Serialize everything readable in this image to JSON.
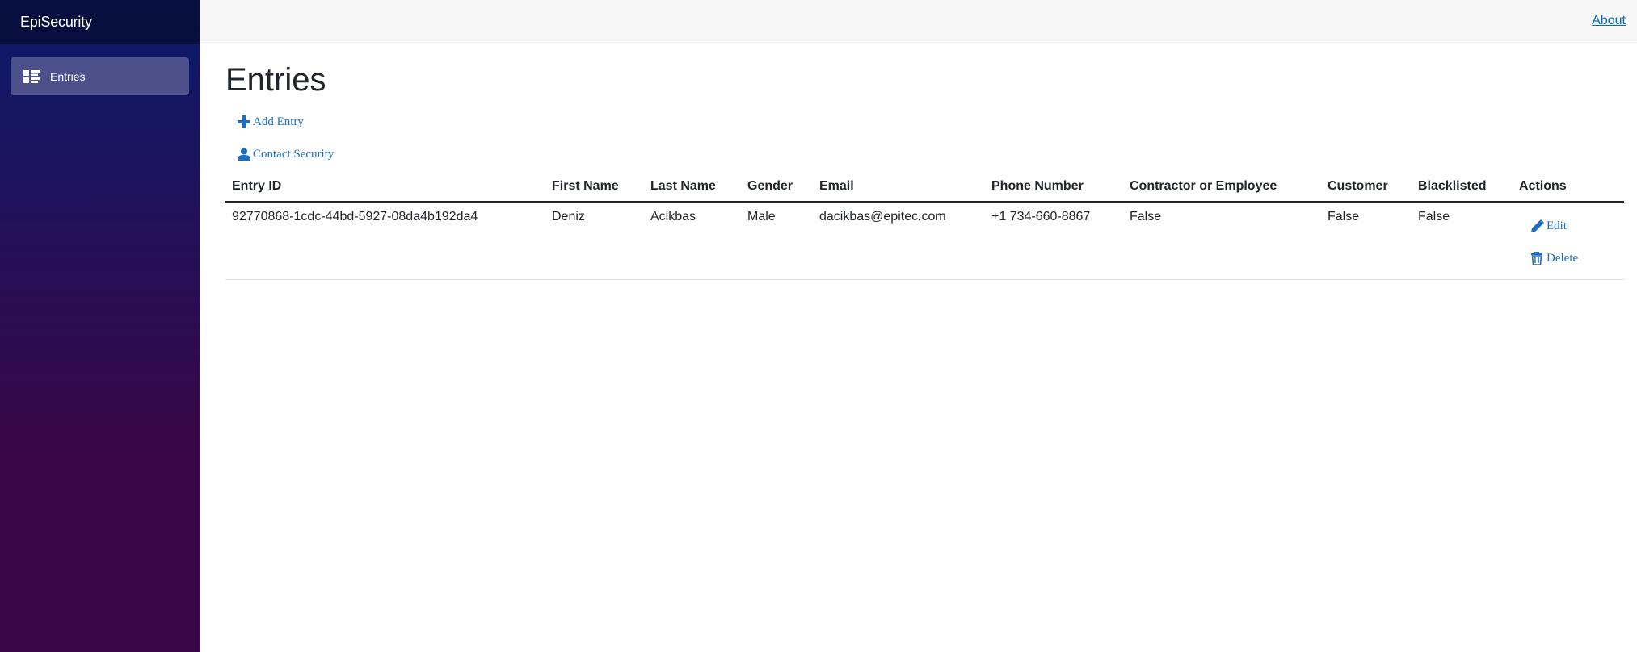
{
  "brand": "EpiSecurity",
  "nav": {
    "items": [
      {
        "label": "Entries",
        "icon": "list-icon"
      }
    ]
  },
  "topbar": {
    "about_label": "About"
  },
  "page": {
    "title": "Entries",
    "add_entry_label": "Add Entry",
    "contact_security_label": "Contact Security"
  },
  "table": {
    "headers": [
      "Entry ID",
      "First Name",
      "Last Name",
      "Gender",
      "Email",
      "Phone Number",
      "Contractor or Employee",
      "Customer",
      "Blacklisted",
      "Actions"
    ],
    "rows": [
      {
        "entry_id": "92770868-1cdc-44bd-5927-08da4b192da4",
        "first_name": "Deniz",
        "last_name": "Acikbas",
        "gender": "Male",
        "email": "dacikbas@epitec.com",
        "phone": "+1 734-660-8867",
        "contractor_or_employee": "False",
        "customer": "False",
        "blacklisted": "False",
        "edit_label": "Edit",
        "delete_label": "Delete"
      }
    ]
  },
  "colors": {
    "link": "#1b6ec2",
    "about_link": "#006bb7",
    "sidebar_top": "#0a1a6a",
    "sidebar_bottom": "#3a0647"
  }
}
